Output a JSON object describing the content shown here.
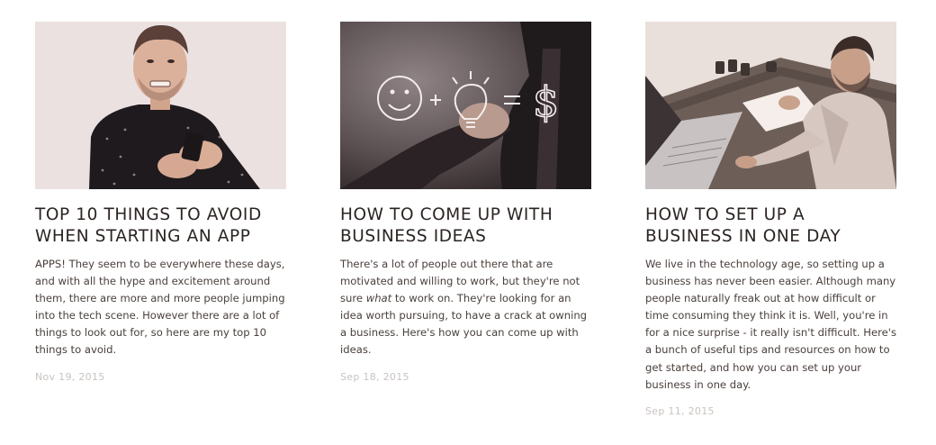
{
  "posts": [
    {
      "title": "TOP 10 THINGS TO AVOID WHEN STARTING AN APP",
      "excerpt": "APPS! They seem to be everywhere these days, and with all the hype and excitement around them, there are more and more people jumping into the tech scene. However there are a lot of things to look out for, so here are my top 10 things to avoid.",
      "date": "Nov 19, 2015"
    },
    {
      "title": "HOW TO COME UP WITH BUSINESS IDEAS",
      "excerpt_before": "There's a lot of people out there that are motivated and willing to work, but they're not sure ",
      "excerpt_emphasis": "what",
      "excerpt_after": " to work on. They're looking for an idea worth pursuing, to have a crack at owning a business. Here's how you can come up with ideas.",
      "date": "Sep 18, 2015"
    },
    {
      "title": "HOW TO SET UP A BUSINESS IN ONE DAY",
      "excerpt": "We live in the technology age, so setting up a business has never been easier. Although many people naturally freak out at how difficult or time consuming they think it is. Well, you're in for a nice surprise - it really isn't difficult. Here's a bunch of useful tips and resources on how to get started, and how you can set up your business in one day.",
      "date": "Sep 11, 2015"
    }
  ]
}
